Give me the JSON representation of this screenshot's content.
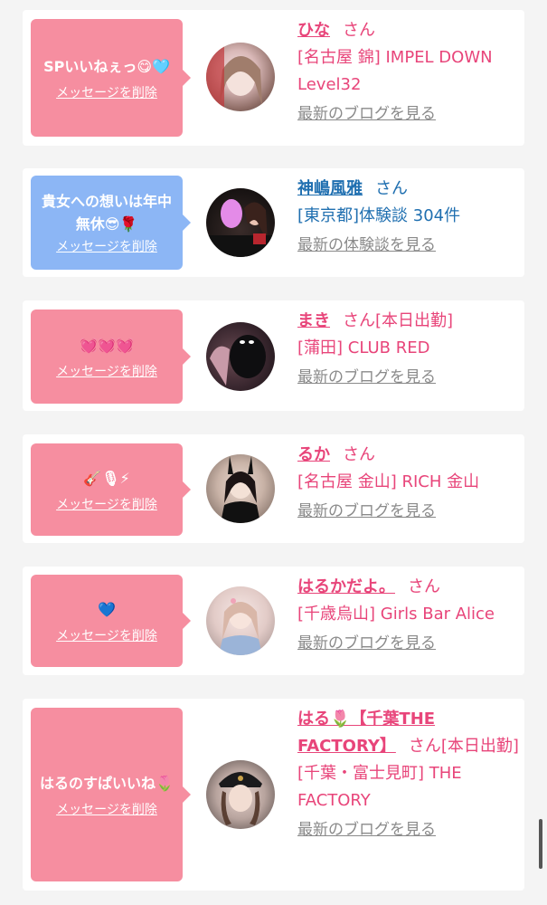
{
  "items": [
    {
      "message": "SPいいねぇっ😋🩵",
      "delete_label": "メッセージを削除",
      "name": "ひな",
      "honorific": "さん",
      "honorific_extra": "",
      "shop": "[名古屋 錦] IMPEL DOWN Level32",
      "link": "最新のブログを見る",
      "color": "pink"
    },
    {
      "message": "貴女への想いは年中無休😎🌹",
      "delete_label": "メッセージを削除",
      "name": "神嶋風雅",
      "honorific": "さん",
      "honorific_extra": "",
      "shop": "[東京都]体験談 304件",
      "link": "最新の体験談を見る",
      "color": "blue"
    },
    {
      "message": "💓💓💓",
      "delete_label": "メッセージを削除",
      "name": "まき",
      "honorific": "さん",
      "honorific_extra": "[本日出勤]",
      "shop": "[蒲田] CLUB RED",
      "link": "最新のブログを見る",
      "color": "pink"
    },
    {
      "message": "🎸🎙⚡",
      "delete_label": "メッセージを削除",
      "name": "るか",
      "honorific": "さん",
      "honorific_extra": "",
      "shop": "[名古屋 金山] RICH 金山",
      "link": "最新のブログを見る",
      "color": "pink"
    },
    {
      "message": "💙",
      "delete_label": "メッセージを削除",
      "name": "はるかだよ。",
      "honorific": "さん",
      "honorific_extra": "",
      "shop": "[千歳烏山] Girls Bar Alice",
      "link": "最新のブログを見る",
      "color": "pink"
    },
    {
      "message": "はるのすぱいいね🌷",
      "delete_label": "メッセージを削除",
      "name": "はる🌷【千葉THE FACTORY】",
      "honorific": "さん",
      "honorific_extra": "[本日出勤]",
      "shop": "[千葉・富士見町] THE FACTORY",
      "link": "最新のブログを見る",
      "color": "pink"
    }
  ],
  "colors": {
    "pink_bubble": "#f68ea0",
    "blue_bubble": "#8cb6f5",
    "pink_text": "#e8457a",
    "blue_text": "#1f6fb0",
    "link_gray": "#8a8a8a"
  }
}
